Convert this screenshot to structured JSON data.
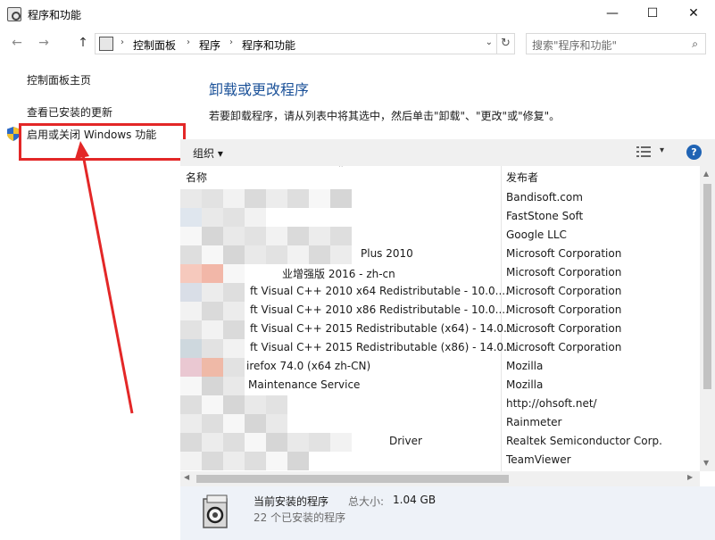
{
  "window": {
    "title": "程序和功能",
    "min_symbol": "—",
    "max_symbol": "☐",
    "close_symbol": "✕"
  },
  "nav": {
    "back_symbol": "←",
    "forward_symbol": "→",
    "up_symbol": "↑",
    "breadcrumb": [
      "控制面板",
      "程序",
      "程序和功能"
    ],
    "crumb_sep": "›",
    "dropdown_symbol": "⌄",
    "refresh_symbol": "↻",
    "search_placeholder": "搜索\"程序和功能\"",
    "search_symbol": "⌕"
  },
  "sidebar": {
    "items": [
      {
        "label": "控制面板主页"
      },
      {
        "label": "查看已安装的更新"
      },
      {
        "label": "启用或关闭 Windows 功能"
      }
    ]
  },
  "main": {
    "title": "卸载或更改程序",
    "description": "若要卸载程序，请从列表中将其选中，然后单击\"卸载\"、\"更改\"或\"修复\"。"
  },
  "toolbar": {
    "organize_label": "组织 ▾",
    "view_drop": "▾",
    "help_label": "?"
  },
  "list": {
    "columns": {
      "name": "名称",
      "publisher": "发布者"
    },
    "sort_symbol": "⌃",
    "rows": [
      {
        "name": "",
        "publisher": "Bandisoft.com"
      },
      {
        "name": "",
        "publisher": "FastStone Soft"
      },
      {
        "name": "",
        "publisher": "Google LLC"
      },
      {
        "name": "Plus 2010",
        "publisher": "Microsoft Corporation"
      },
      {
        "name": "业增强版 2016  - zh-cn",
        "publisher": "Microsoft Corporation"
      },
      {
        "name": "ft Visual C++ 2010  x64 Redistributable - 10.0....",
        "publisher": "Microsoft Corporation"
      },
      {
        "name": "ft Visual C++ 2010  x86 Redistributable - 10.0....",
        "publisher": "Microsoft Corporation"
      },
      {
        "name": "ft Visual C++ 2015 Redistributable (x64) - 14.0....",
        "publisher": "Microsoft Corporation"
      },
      {
        "name": "ft Visual C++ 2015 Redistributable (x86) - 14.0....",
        "publisher": "Microsoft Corporation"
      },
      {
        "name": "irefox 74.0 (x64 zh-CN)",
        "publisher": "Mozilla"
      },
      {
        "name": "Maintenance Service",
        "publisher": "Mozilla"
      },
      {
        "name": "",
        "publisher": "http://ohsoft.net/"
      },
      {
        "name": "",
        "publisher": "Rainmeter"
      },
      {
        "name": "Driver",
        "publisher": "Realtek Semiconductor Corp."
      },
      {
        "name": "",
        "publisher": "TeamViewer"
      }
    ]
  },
  "status": {
    "title": "当前安装的程序",
    "size_label": "总大小:",
    "size_value": "1.04 GB",
    "count": "22 个已安装的程序"
  },
  "colors": {
    "annotation_red": "#e32727",
    "title_blue": "#1c5299",
    "status_bg": "#eef2f8"
  }
}
